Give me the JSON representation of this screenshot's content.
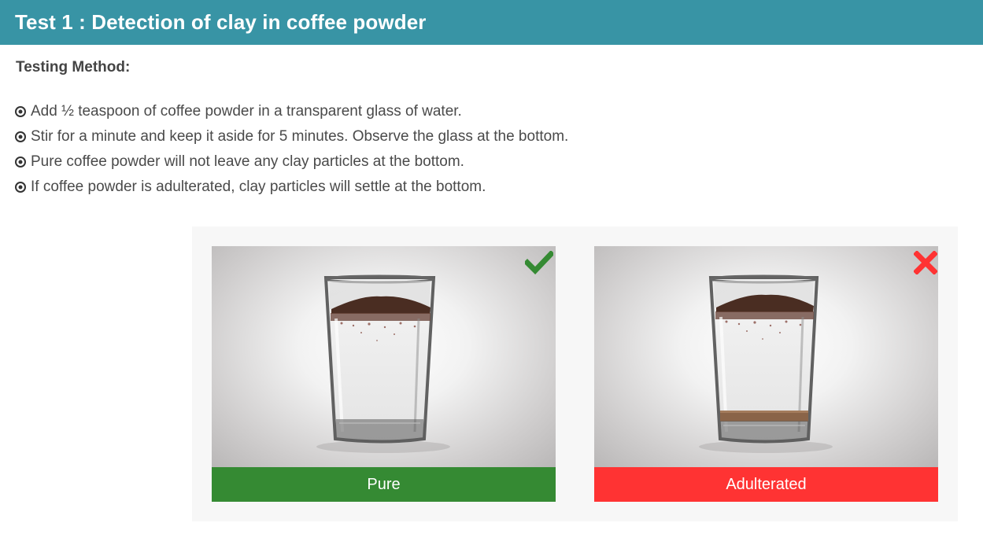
{
  "header": {
    "title": "Test 1 : Detection of clay in coffee powder"
  },
  "method": {
    "label": "Testing Method:",
    "steps": [
      "Add ½ teaspoon of coffee powder in a transparent glass of water.",
      "Stir for a minute and keep it aside for 5 minutes. Observe the glass at the bottom.",
      "Pure coffee powder will not leave any clay particles at the bottom.",
      "If coffee powder is adulterated, clay particles will settle at the bottom."
    ]
  },
  "results": {
    "pure": {
      "caption": "Pure",
      "color": "#358a33",
      "icon": "checkmark-icon"
    },
    "adulterated": {
      "caption": "Adulterated",
      "color": "#ff3333",
      "icon": "cross-icon"
    }
  },
  "colors": {
    "header_bg": "#3894a5",
    "panel_bg": "#f7f7f7"
  }
}
